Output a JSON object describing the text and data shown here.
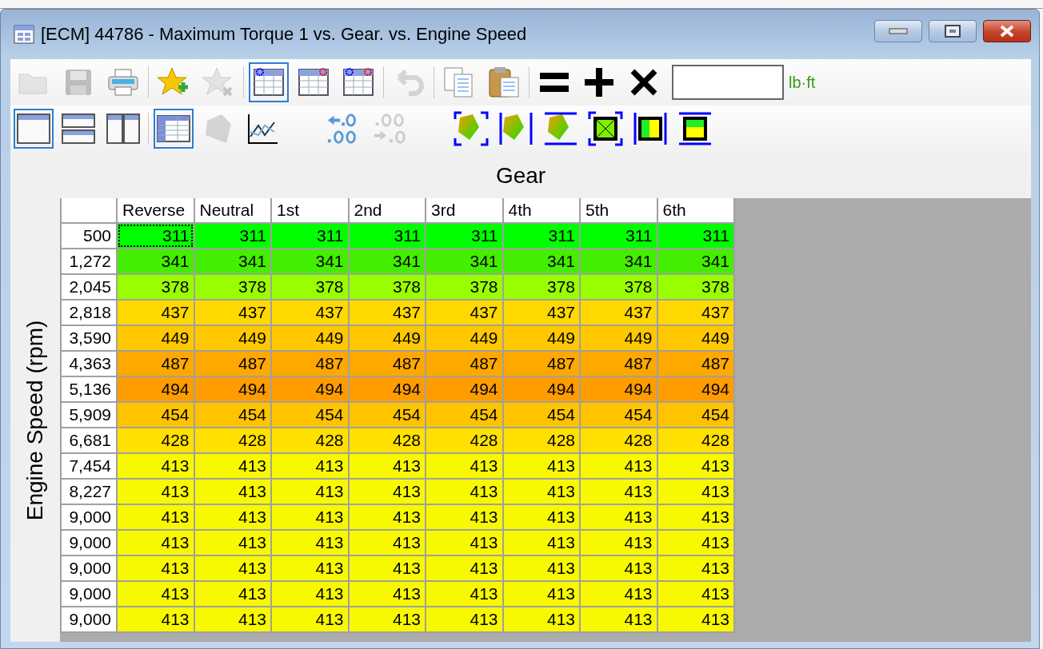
{
  "window": {
    "title": "[ECM] 44786 - Maximum Torque 1 vs. Gear. vs. Engine Speed"
  },
  "toolbar_1": [
    {
      "kind": "open",
      "disabled": true,
      "selected": false
    },
    {
      "kind": "save",
      "disabled": true,
      "selected": false
    },
    {
      "kind": "print",
      "disabled": false,
      "selected": false
    },
    {
      "kind": "sep"
    },
    {
      "kind": "fav-add",
      "disabled": false,
      "selected": false
    },
    {
      "kind": "fav-remove",
      "disabled": true,
      "selected": false
    },
    {
      "kind": "sep"
    },
    {
      "kind": "table-x",
      "disabled": false,
      "selected": true
    },
    {
      "kind": "table-y",
      "disabled": false,
      "selected": false
    },
    {
      "kind": "table-xy",
      "disabled": false,
      "selected": false
    },
    {
      "kind": "sep"
    },
    {
      "kind": "undo",
      "disabled": true,
      "selected": false
    },
    {
      "kind": "sep"
    },
    {
      "kind": "copy",
      "disabled": false,
      "selected": false
    },
    {
      "kind": "paste",
      "disabled": false,
      "selected": false
    },
    {
      "kind": "sep"
    },
    {
      "kind": "equals",
      "disabled": false,
      "selected": false
    },
    {
      "kind": "plus",
      "disabled": false,
      "selected": false
    },
    {
      "kind": "times",
      "disabled": false,
      "selected": false
    }
  ],
  "value_field": {
    "unit": "lb·ft"
  },
  "toolbar_2": [
    {
      "kind": "view-single",
      "disabled": false,
      "selected": true
    },
    {
      "kind": "view-rows",
      "disabled": false,
      "selected": false
    },
    {
      "kind": "view-cols",
      "disabled": false,
      "selected": false
    },
    {
      "kind": "sep"
    },
    {
      "kind": "table-view",
      "disabled": false,
      "selected": true
    },
    {
      "kind": "surface",
      "disabled": true,
      "selected": false
    },
    {
      "kind": "graph",
      "disabled": false,
      "selected": false
    },
    {
      "kind": "gap"
    },
    {
      "kind": "dec-less",
      "disabled": false,
      "selected": false
    },
    {
      "kind": "dec-more",
      "disabled": true,
      "selected": false
    },
    {
      "kind": "gap"
    },
    {
      "kind": "fit-all",
      "disabled": false,
      "selected": false
    },
    {
      "kind": "fit-h",
      "disabled": false,
      "selected": false
    },
    {
      "kind": "fit-v",
      "disabled": false,
      "selected": false
    },
    {
      "kind": "fit-box",
      "disabled": false,
      "selected": false
    },
    {
      "kind": "fit-cols",
      "disabled": false,
      "selected": false
    },
    {
      "kind": "fit-rows",
      "disabled": false,
      "selected": false
    }
  ],
  "table": {
    "x_axis_title": "Gear",
    "y_axis_title": "Engine Speed (rpm)",
    "columns": [
      "Reverse",
      "Neutral",
      "1st",
      "2nd",
      "3rd",
      "4th",
      "5th",
      "6th"
    ],
    "rows": [
      {
        "label": "500",
        "color": "#00ff00",
        "cells": [
          {
            "text": "311",
            "selected": true
          },
          {
            "text": "311",
            "selected": false
          },
          {
            "text": "311",
            "selected": false
          },
          {
            "text": "311",
            "selected": false
          },
          {
            "text": "311",
            "selected": false
          },
          {
            "text": "311",
            "selected": false
          },
          {
            "text": "311",
            "selected": false
          },
          {
            "text": "311",
            "selected": false
          }
        ]
      },
      {
        "label": "1,272",
        "color": "#44ee00",
        "cells": [
          {
            "text": "341",
            "selected": false
          },
          {
            "text": "341",
            "selected": false
          },
          {
            "text": "341",
            "selected": false
          },
          {
            "text": "341",
            "selected": false
          },
          {
            "text": "341",
            "selected": false
          },
          {
            "text": "341",
            "selected": false
          },
          {
            "text": "341",
            "selected": false
          },
          {
            "text": "341",
            "selected": false
          }
        ]
      },
      {
        "label": "2,045",
        "color": "#99ff00",
        "cells": [
          {
            "text": "378",
            "selected": false
          },
          {
            "text": "378",
            "selected": false
          },
          {
            "text": "378",
            "selected": false
          },
          {
            "text": "378",
            "selected": false
          },
          {
            "text": "378",
            "selected": false
          },
          {
            "text": "378",
            "selected": false
          },
          {
            "text": "378",
            "selected": false
          },
          {
            "text": "378",
            "selected": false
          }
        ]
      },
      {
        "label": "2,818",
        "color": "#ffd800",
        "cells": [
          {
            "text": "437",
            "selected": false
          },
          {
            "text": "437",
            "selected": false
          },
          {
            "text": "437",
            "selected": false
          },
          {
            "text": "437",
            "selected": false
          },
          {
            "text": "437",
            "selected": false
          },
          {
            "text": "437",
            "selected": false
          },
          {
            "text": "437",
            "selected": false
          },
          {
            "text": "437",
            "selected": false
          }
        ]
      },
      {
        "label": "3,590",
        "color": "#ffc800",
        "cells": [
          {
            "text": "449",
            "selected": false
          },
          {
            "text": "449",
            "selected": false
          },
          {
            "text": "449",
            "selected": false
          },
          {
            "text": "449",
            "selected": false
          },
          {
            "text": "449",
            "selected": false
          },
          {
            "text": "449",
            "selected": false
          },
          {
            "text": "449",
            "selected": false
          },
          {
            "text": "449",
            "selected": false
          }
        ]
      },
      {
        "label": "4,363",
        "color": "#ffa800",
        "cells": [
          {
            "text": "487",
            "selected": false
          },
          {
            "text": "487",
            "selected": false
          },
          {
            "text": "487",
            "selected": false
          },
          {
            "text": "487",
            "selected": false
          },
          {
            "text": "487",
            "selected": false
          },
          {
            "text": "487",
            "selected": false
          },
          {
            "text": "487",
            "selected": false
          },
          {
            "text": "487",
            "selected": false
          }
        ]
      },
      {
        "label": "5,136",
        "color": "#ff9c00",
        "cells": [
          {
            "text": "494",
            "selected": false
          },
          {
            "text": "494",
            "selected": false
          },
          {
            "text": "494",
            "selected": false
          },
          {
            "text": "494",
            "selected": false
          },
          {
            "text": "494",
            "selected": false
          },
          {
            "text": "494",
            "selected": false
          },
          {
            "text": "494",
            "selected": false
          },
          {
            "text": "494",
            "selected": false
          }
        ]
      },
      {
        "label": "5,909",
        "color": "#ffc400",
        "cells": [
          {
            "text": "454",
            "selected": false
          },
          {
            "text": "454",
            "selected": false
          },
          {
            "text": "454",
            "selected": false
          },
          {
            "text": "454",
            "selected": false
          },
          {
            "text": "454",
            "selected": false
          },
          {
            "text": "454",
            "selected": false
          },
          {
            "text": "454",
            "selected": false
          },
          {
            "text": "454",
            "selected": false
          }
        ]
      },
      {
        "label": "6,681",
        "color": "#ffe000",
        "cells": [
          {
            "text": "428",
            "selected": false
          },
          {
            "text": "428",
            "selected": false
          },
          {
            "text": "428",
            "selected": false
          },
          {
            "text": "428",
            "selected": false
          },
          {
            "text": "428",
            "selected": false
          },
          {
            "text": "428",
            "selected": false
          },
          {
            "text": "428",
            "selected": false
          },
          {
            "text": "428",
            "selected": false
          }
        ]
      },
      {
        "label": "7,454",
        "color": "#f8f800",
        "cells": [
          {
            "text": "413",
            "selected": false
          },
          {
            "text": "413",
            "selected": false
          },
          {
            "text": "413",
            "selected": false
          },
          {
            "text": "413",
            "selected": false
          },
          {
            "text": "413",
            "selected": false
          },
          {
            "text": "413",
            "selected": false
          },
          {
            "text": "413",
            "selected": false
          },
          {
            "text": "413",
            "selected": false
          }
        ]
      },
      {
        "label": "8,227",
        "color": "#f8f800",
        "cells": [
          {
            "text": "413",
            "selected": false
          },
          {
            "text": "413",
            "selected": false
          },
          {
            "text": "413",
            "selected": false
          },
          {
            "text": "413",
            "selected": false
          },
          {
            "text": "413",
            "selected": false
          },
          {
            "text": "413",
            "selected": false
          },
          {
            "text": "413",
            "selected": false
          },
          {
            "text": "413",
            "selected": false
          }
        ]
      },
      {
        "label": "9,000",
        "color": "#f8f800",
        "cells": [
          {
            "text": "413",
            "selected": false
          },
          {
            "text": "413",
            "selected": false
          },
          {
            "text": "413",
            "selected": false
          },
          {
            "text": "413",
            "selected": false
          },
          {
            "text": "413",
            "selected": false
          },
          {
            "text": "413",
            "selected": false
          },
          {
            "text": "413",
            "selected": false
          },
          {
            "text": "413",
            "selected": false
          }
        ]
      },
      {
        "label": "9,000",
        "color": "#f8f800",
        "cells": [
          {
            "text": "413",
            "selected": false
          },
          {
            "text": "413",
            "selected": false
          },
          {
            "text": "413",
            "selected": false
          },
          {
            "text": "413",
            "selected": false
          },
          {
            "text": "413",
            "selected": false
          },
          {
            "text": "413",
            "selected": false
          },
          {
            "text": "413",
            "selected": false
          },
          {
            "text": "413",
            "selected": false
          }
        ]
      },
      {
        "label": "9,000",
        "color": "#f8f800",
        "cells": [
          {
            "text": "413",
            "selected": false
          },
          {
            "text": "413",
            "selected": false
          },
          {
            "text": "413",
            "selected": false
          },
          {
            "text": "413",
            "selected": false
          },
          {
            "text": "413",
            "selected": false
          },
          {
            "text": "413",
            "selected": false
          },
          {
            "text": "413",
            "selected": false
          },
          {
            "text": "413",
            "selected": false
          }
        ]
      },
      {
        "label": "9,000",
        "color": "#f8f800",
        "cells": [
          {
            "text": "413",
            "selected": false
          },
          {
            "text": "413",
            "selected": false
          },
          {
            "text": "413",
            "selected": false
          },
          {
            "text": "413",
            "selected": false
          },
          {
            "text": "413",
            "selected": false
          },
          {
            "text": "413",
            "selected": false
          },
          {
            "text": "413",
            "selected": false
          },
          {
            "text": "413",
            "selected": false
          }
        ]
      },
      {
        "label": "9,000",
        "color": "#f8f800",
        "cells": [
          {
            "text": "413",
            "selected": false
          },
          {
            "text": "413",
            "selected": false
          },
          {
            "text": "413",
            "selected": false
          },
          {
            "text": "413",
            "selected": false
          },
          {
            "text": "413",
            "selected": false
          },
          {
            "text": "413",
            "selected": false
          },
          {
            "text": "413",
            "selected": false
          },
          {
            "text": "413",
            "selected": false
          }
        ]
      }
    ]
  }
}
